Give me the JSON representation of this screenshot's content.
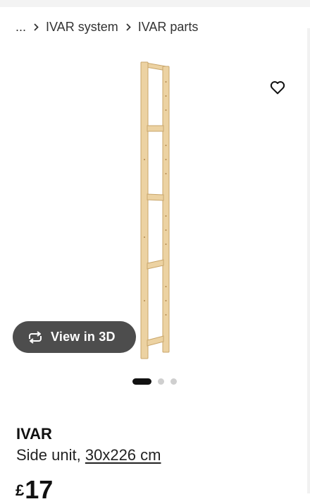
{
  "breadcrumb": {
    "items": [
      "...",
      "IVAR system",
      "IVAR parts"
    ]
  },
  "icons": {
    "separator": "chevron-right-icon",
    "favourite": "heart-outline-icon",
    "rotate": "rotate-arrows-icon"
  },
  "gallery": {
    "view_3d_label": "View in 3D",
    "slide_count": 3,
    "active_slide": 1
  },
  "product": {
    "name": "IVAR",
    "description": "Side unit,",
    "size": "30x226 cm",
    "price_currency": "£",
    "price": "17"
  },
  "colors": {
    "view_3d_button": "#4d4d4d",
    "wood": "#ecd2a2",
    "active_dot": "#111111",
    "inactive_dot": "#cfcfcf"
  }
}
